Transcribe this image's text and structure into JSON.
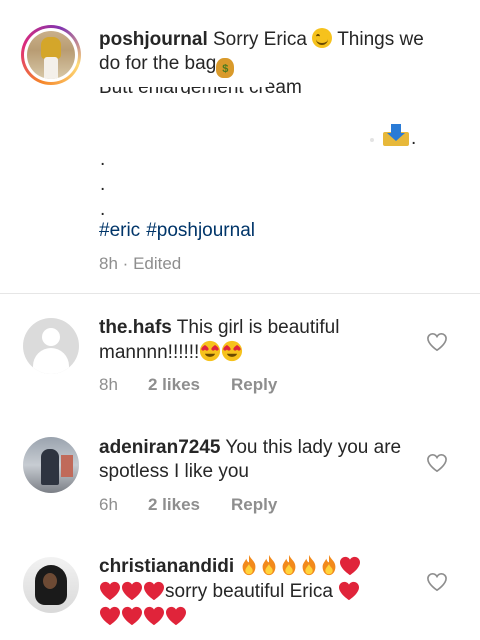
{
  "caption": {
    "username": "poshjournal",
    "text_1": " Sorry Erica ",
    "text_2": " Things we do for the bag",
    "clipped_text": "Butt enlargement cream",
    "dots": [
      ".",
      ".",
      "."
    ],
    "hashtags": [
      "#eric",
      "#poshjournal"
    ],
    "time": "8h",
    "separator": "·",
    "edited": "Edited",
    "emojis": [
      "smiling-face-emoji",
      "money-bag-emoji",
      "inbox-tray-emoji"
    ]
  },
  "comments": [
    {
      "username": "the.hafs",
      "text": " This girl is beautiful mannnn!!!!!!",
      "time": "8h",
      "likes": "2 likes",
      "reply": "Reply",
      "emojis": [
        "heart-eyes-emoji",
        "heart-eyes-emoji"
      ]
    },
    {
      "username": "adeniran7245",
      "text": " You this lady you are spotless I like you",
      "time": "6h",
      "likes": "2 likes",
      "reply": "Reply"
    },
    {
      "username": "christianandidi",
      "text_mid": "sorry beautiful Erica",
      "emojis": [
        "fire-emoji",
        "red-heart-emoji"
      ]
    }
  ],
  "icons": {
    "like": "heart-outline-icon"
  },
  "colors": {
    "hashtag": "#003569",
    "meta": "#8e8e8e",
    "text": "#262626",
    "divider": "#e6e6e6",
    "heart": "#e0243a",
    "fire": "#f28a1c"
  }
}
